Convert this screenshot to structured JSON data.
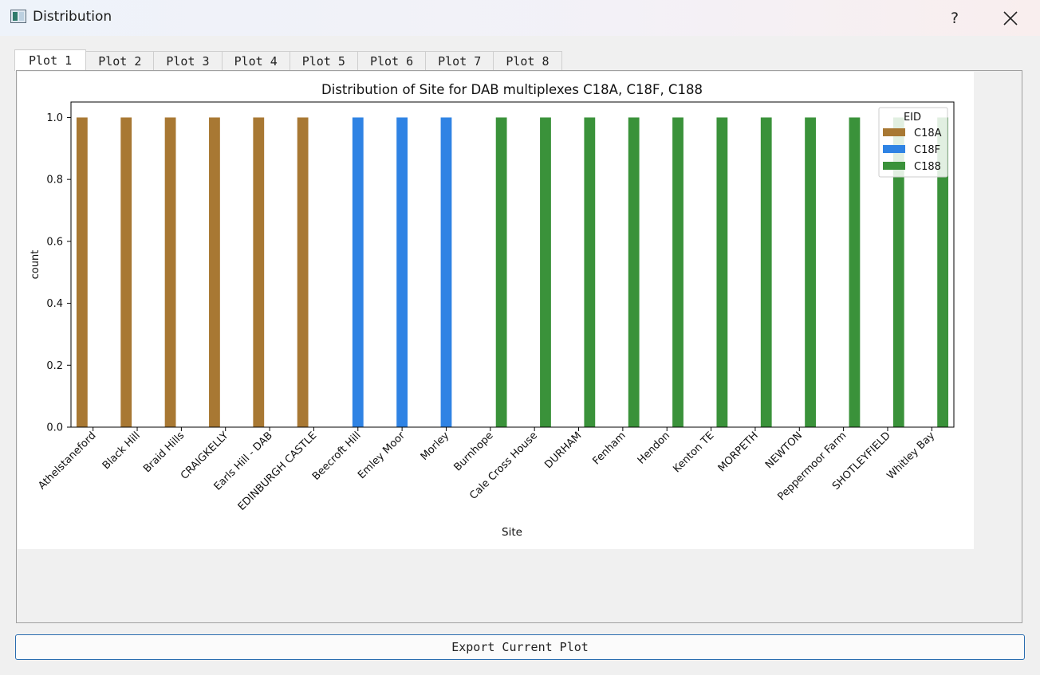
{
  "window": {
    "title": "Distribution",
    "help_label": "?"
  },
  "tabs": [
    "Plot 1",
    "Plot 2",
    "Plot 3",
    "Plot 4",
    "Plot 5",
    "Plot 6",
    "Plot 7",
    "Plot 8"
  ],
  "active_tab": 0,
  "export_button": {
    "label": "Export Current Plot"
  },
  "chart_data": {
    "type": "bar",
    "title": "Distribution of Site for DAB multiplexes C18A, C18F, C188",
    "xlabel": "Site",
    "ylabel": "count",
    "ylim": [
      0,
      1.05
    ],
    "yticks": [
      0.0,
      0.2,
      0.4,
      0.6,
      0.8,
      1.0
    ],
    "grid": false,
    "legend": {
      "title": "EID",
      "placement": "top-right"
    },
    "categories": [
      "Athelstaneford",
      "Black Hill",
      "Braid Hills",
      "CRAIGKELLY",
      "Earls Hill - DAB",
      "EDINBURGH CASTLE",
      "Beecroft Hill",
      "Emley Moor",
      "Morley",
      "Burnhope",
      "Cale Cross House",
      "DURHAM",
      "Fenham",
      "Hendon",
      "Kenton TE",
      "MORPETH",
      "NEWTON",
      "Peppermoor Farm",
      "SHOTLEYFIELD",
      "Whitley Bay"
    ],
    "series": [
      {
        "name": "C18A",
        "color": "#a87833",
        "values": [
          1,
          1,
          1,
          1,
          1,
          1,
          0,
          0,
          0,
          0,
          0,
          0,
          0,
          0,
          0,
          0,
          0,
          0,
          0,
          0
        ]
      },
      {
        "name": "C18F",
        "color": "#2f83e4",
        "values": [
          0,
          0,
          0,
          0,
          0,
          0,
          1,
          1,
          1,
          0,
          0,
          0,
          0,
          0,
          0,
          0,
          0,
          0,
          0,
          0
        ]
      },
      {
        "name": "C188",
        "color": "#3a923a",
        "values": [
          0,
          0,
          0,
          0,
          0,
          0,
          0,
          0,
          0,
          1,
          1,
          1,
          1,
          1,
          1,
          1,
          1,
          1,
          1,
          1
        ]
      }
    ]
  }
}
